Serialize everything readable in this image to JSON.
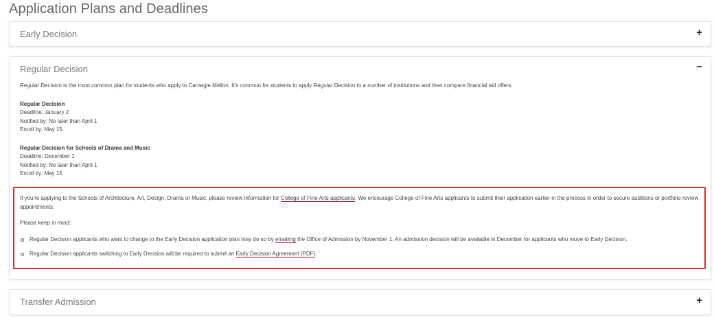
{
  "page": {
    "title": "Application Plans and Deadlines"
  },
  "panels": {
    "early_decision": {
      "title": "Early Decision",
      "toggle": "+"
    },
    "regular_decision": {
      "title": "Regular Decision",
      "toggle": "−",
      "intro": "Regular Decision is the most common plan for students who apply to Carnegie Mellon. It's common for students to apply Regular Decision to a number of institutions and then compare financial aid offers.",
      "plans": [
        {
          "name": "Regular Decision",
          "deadline": "Deadline: January 2",
          "notified": "Notified by: No later than April 1",
          "enroll": "Enroll by: May 15"
        },
        {
          "name": "Regular Decision for Schools of Drama and Music",
          "deadline": "Deadline: December 1",
          "notified": "Notified by: No later than April 1",
          "enroll": "Enroll by: May 15"
        }
      ],
      "callout": {
        "p1_before": "If you're applying to the Schools of Architecture, Art, Design, Drama or Music, please review information for ",
        "p1_link": "College of Fine Arts applicants",
        "p1_after": ".  We encourage College of Fine Arts applicants to submit their application earlier in the process in order to secure auditions or portfolio review appointments.",
        "keep_in_mind": "Please keep in mind:",
        "bullet1_before": "Regular Decision applicants who want to change to the Early Decision application plan may do so by ",
        "bullet1_link": "emailing",
        "bullet1_after": " the Office of Admission by November 1. An admission decision will be available in December for applicants who move to Early Decision.",
        "bullet2_before": "Regular Decision applicants switching to Early Decision will be required to submit an ",
        "bullet2_link": "Early Decision Agreement (PDF)",
        "bullet2_after": "."
      }
    },
    "transfer_admission": {
      "title": "Transfer Admission",
      "toggle": "+"
    }
  },
  "colors": {
    "callout_border": "#d32f2f",
    "link_underline": "#c41230"
  }
}
